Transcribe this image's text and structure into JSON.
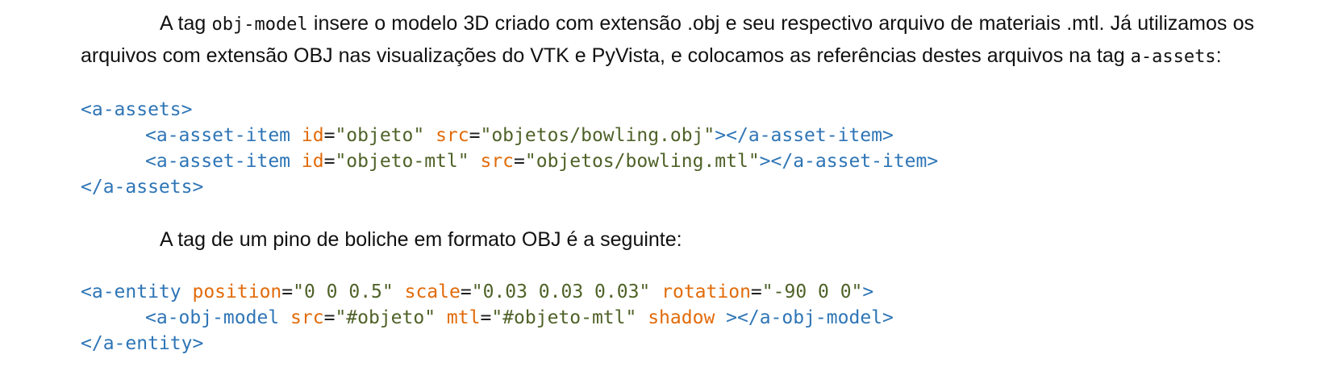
{
  "paragraph1": {
    "part1": "A tag ",
    "code1": "obj-model",
    "part2": " insere o modelo 3D criado com extensão .obj e seu respectivo arquivo de materiais .mtl. Já utilizamos os arquivos com extensão OBJ nas visualizações do VTK e PyVista, e colocamos as referências destes arquivos na tag ",
    "code2": "a-assets",
    "part3": ":"
  },
  "code_assets": {
    "open_tag": "<a-assets>",
    "item1": {
      "tag": "<a-asset-item",
      "id_attr": "id",
      "id_val": "\"objeto\"",
      "src_attr": "src",
      "src_val": "\"objetos/bowling.obj\"",
      "close": "></a-asset-item>"
    },
    "item2": {
      "tag": "<a-asset-item",
      "id_attr": "id",
      "id_val": "\"objeto-mtl\"",
      "src_attr": "src",
      "src_val": "\"objetos/bowling.mtl\"",
      "close": "></a-asset-item>"
    },
    "close_tag": "</a-assets>"
  },
  "paragraph2": {
    "text": "A tag de um pino de boliche em formato OBJ é a seguinte:"
  },
  "code_entity": {
    "open_tag": "<a-entity",
    "position_attr": "position",
    "position_val": "\"0 0 0.5\"",
    "scale_attr": "scale",
    "scale_val": "\"0.03 0.03 0.03\"",
    "rotation_attr": "rotation",
    "rotation_val": "\"-90 0 0\"",
    "open_end": ">",
    "model_tag": "<a-obj-model",
    "src_attr": "src",
    "src_val": "\"#objeto\"",
    "mtl_attr": "mtl",
    "mtl_val": "\"#objeto-mtl\"",
    "shadow_attr": "shadow",
    "model_close": "></a-obj-model>",
    "close_tag": "</a-entity>"
  },
  "syntax_colors": {
    "tag": "#2e75b6",
    "attribute": "#e26b0a",
    "string": "#4f6228",
    "text": "#111111"
  }
}
